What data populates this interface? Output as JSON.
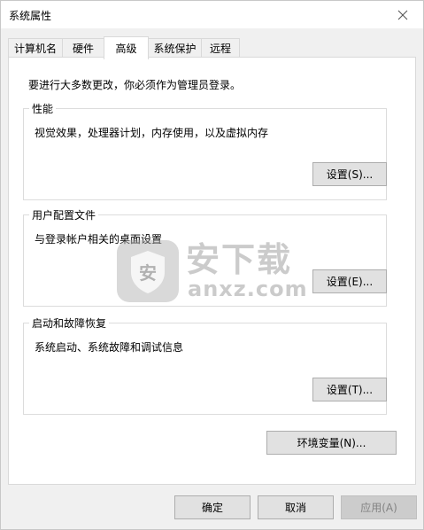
{
  "window": {
    "title": "系统属性"
  },
  "tabs": [
    {
      "label": "计算机名"
    },
    {
      "label": "硬件"
    },
    {
      "label": "高级"
    },
    {
      "label": "系统保护"
    },
    {
      "label": "远程"
    }
  ],
  "advanced": {
    "admin_note": "要进行大多数更改，你必须作为管理员登录。",
    "performance": {
      "title": "性能",
      "desc": "视觉效果，处理器计划，内存使用，以及虚拟内存",
      "button": "设置(S)..."
    },
    "user_profiles": {
      "title": "用户配置文件",
      "desc": "与登录帐户相关的桌面设置",
      "button": "设置(E)..."
    },
    "startup_recovery": {
      "title": "启动和故障恢复",
      "desc": "系统启动、系统故障和调试信息",
      "button": "设置(T)..."
    },
    "env_button": "环境变量(N)..."
  },
  "dialog_buttons": {
    "ok": "确定",
    "cancel": "取消",
    "apply": "应用(A)"
  },
  "watermark": {
    "shield_char": "安",
    "brand": "安下载",
    "url": "anxz.com"
  },
  "icons": {
    "close": "close-icon",
    "shield": "shield-icon"
  },
  "colors": {
    "dialog_bg": "#f0f0f0",
    "panel_bg": "#ffffff",
    "button_bg": "#e1e1e1",
    "button_border": "#adadad",
    "disabled_text": "#838383"
  }
}
